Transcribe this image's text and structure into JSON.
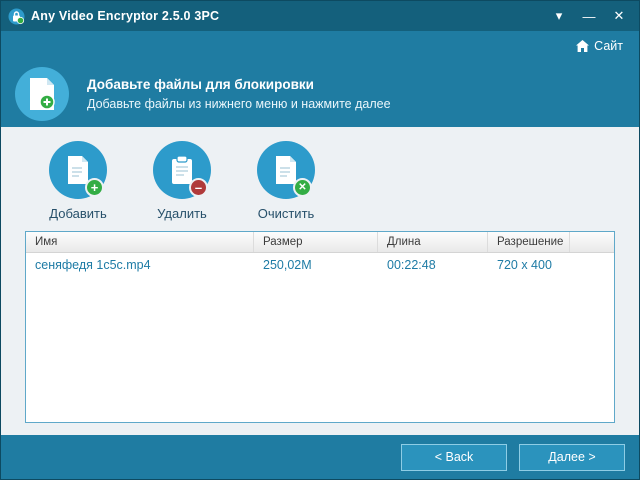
{
  "window": {
    "title": "Any Video Encryptor 2.5.0 3PC",
    "controls": {
      "dropdown": "▾",
      "minimize": "—",
      "close": "✕"
    }
  },
  "sitebar": {
    "site_label": "Сайт"
  },
  "header": {
    "title": "Добавьте файлы для блокировки",
    "subtitle": "Добавьте файлы из нижнего меню и нажмите далее"
  },
  "toolbar": {
    "add_label": "Добавить",
    "remove_label": "Удалить",
    "clear_label": "Очистить",
    "add_badge": "+",
    "remove_badge": "–",
    "clear_badge": "✕"
  },
  "table": {
    "columns": [
      "Имя",
      "Размер",
      "Длина",
      "Разрешение"
    ],
    "rows": [
      [
        "сеняфедя 1c5c.mp4",
        "250,02M",
        "00:22:48",
        "720 x 400"
      ]
    ]
  },
  "footer": {
    "back_label": "< Back",
    "next_label": "Далее >"
  },
  "colors": {
    "titlebar": "#14607c",
    "chrome": "#1f7ca2",
    "main_bg": "#edf1f4",
    "accent_circle": "#2d9bcb",
    "badge_green": "#33ad44",
    "badge_red": "#b03a3a",
    "row_text": "#1e7ba5"
  }
}
